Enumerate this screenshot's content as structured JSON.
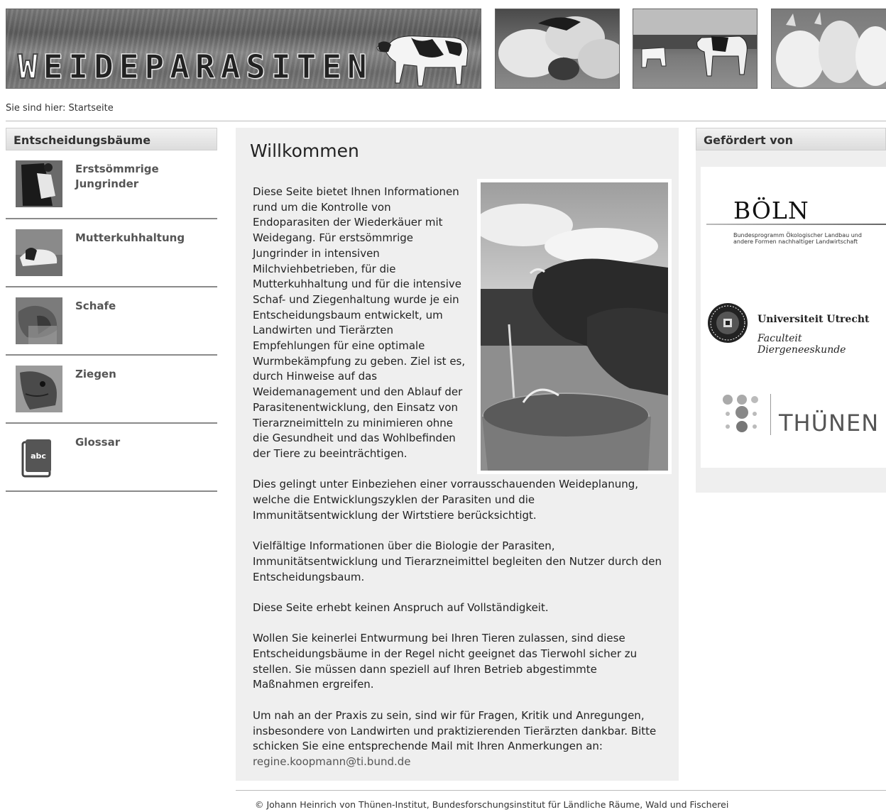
{
  "header": {
    "title_first": "W",
    "title_rest": "EIDEPARASITEN"
  },
  "breadcrumb": "Sie sind hier: Startseite",
  "nav": {
    "heading": "Entscheidungsbäume",
    "items": [
      {
        "label": "Erstsömmrige Jungrinder",
        "icon": "cow-photo"
      },
      {
        "label": "Mutterkuhhaltung",
        "icon": "calf-photo"
      },
      {
        "label": "Schafe",
        "icon": "sheep-photo"
      },
      {
        "label": "Ziegen",
        "icon": "goat-photo"
      },
      {
        "label": "Glossar",
        "icon": "abc-book-icon"
      }
    ]
  },
  "main": {
    "title": "Willkommen",
    "p1": "Diese Seite bietet Ihnen Informationen rund um die Kontrolle von Endoparasiten der Wiederkäuer mit Weidegang. Für erstsömmrige Jungrinder in intensiven Milchviehbetrieben, für die Mutterkuhhaltung und für die intensive Schaf- und Ziegenhaltung wurde je ein Entscheidungsbaum entwickelt, um Landwirten und Tierärzten Empfehlungen für eine optimale Wurmbekämpfung zu geben. Ziel ist es, durch Hinweise auf das Weidemanagement und den Ablauf der Parasitenentwicklung, den Einsatz von Tierarzneimitteln zu minimieren ohne die Gesundheit und das Wohlbefinden der Tiere zu beeinträchtigen.",
    "p2": "Dies gelingt unter Einbeziehen einer vorrausschauenden Weideplanung, welche die Entwicklungszyklen der Parasiten und die Immunitätsentwicklung der Wirtstiere berücksichtigt.",
    "p3": "Vielfältige Informationen über die Biologie der Parasiten, Immunitätsentwicklung und Tierarzneimittel begleiten den Nutzer durch den Entscheidungsbaum.",
    "p4": "Diese Seite erhebt keinen Anspruch auf Vollständigkeit.",
    "p5": "Wollen Sie keinerlei Entwurmung bei Ihren Tieren zulassen, sind diese Entscheidungsbäume in der Regel nicht geeignet das Tierwohl sicher zu stellen. Sie müssen dann speziell auf Ihren Betrieb abgestimmte Maßnahmen ergreifen.",
    "p6": "Um nah an der Praxis zu sein, sind wir für Fragen, Kritik und Anregungen, insbesondere von Landwirten und praktizierenden Tierärzten dankbar. Bitte schicken Sie eine entsprechende Mail mit Ihren Anmerkungen an:",
    "email": "regine.koopmann@ti.bund.de"
  },
  "sponsors": {
    "heading": "Gefördert von",
    "boln_name": "BÖLN",
    "boln_sub": "Bundesprogramm Ökologischer Landbau und andere Formen nachhaltiger Landwirtschaft",
    "uu_name": "Universiteit Utrecht",
    "uu_faculty": "Faculteit Diergeneeskunde",
    "thuenen_name": "THÜNEN"
  },
  "footer": "© Johann Heinrich von Thünen-Institut, Bundesforschungsinstitut für Ländliche Räume, Wald und Fischerei"
}
